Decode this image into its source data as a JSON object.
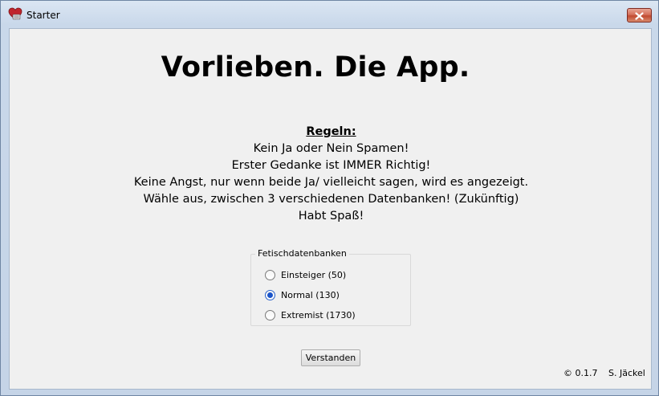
{
  "window": {
    "title": "Starter",
    "icon": "heart-icon",
    "close_icon": "close-icon",
    "accent_close": "#c8513a"
  },
  "main": {
    "headline": "Vorlieben. Die App.",
    "rules_heading": "Regeln:",
    "rules": [
      "Kein Ja oder Nein Spamen!",
      "Erster Gedanke ist IMMER Richtig!",
      "Keine Angst, nur wenn beide Ja/ vielleicht sagen, wird es angezeigt.",
      "Wähle aus, zwischen 3 verschiedenen Datenbanken! (Zukünftig)",
      "Habt Spaß!"
    ]
  },
  "database_group": {
    "title": "Fetischdatenbanken",
    "options": [
      {
        "label": "Einsteiger (50)",
        "checked": false
      },
      {
        "label": "Normal (130)",
        "checked": true
      },
      {
        "label": "Extremist (1730)",
        "checked": false
      }
    ]
  },
  "confirm_button": "Verstanden",
  "footer": {
    "version": "© 0.1.7",
    "author": "S. Jäckel"
  }
}
